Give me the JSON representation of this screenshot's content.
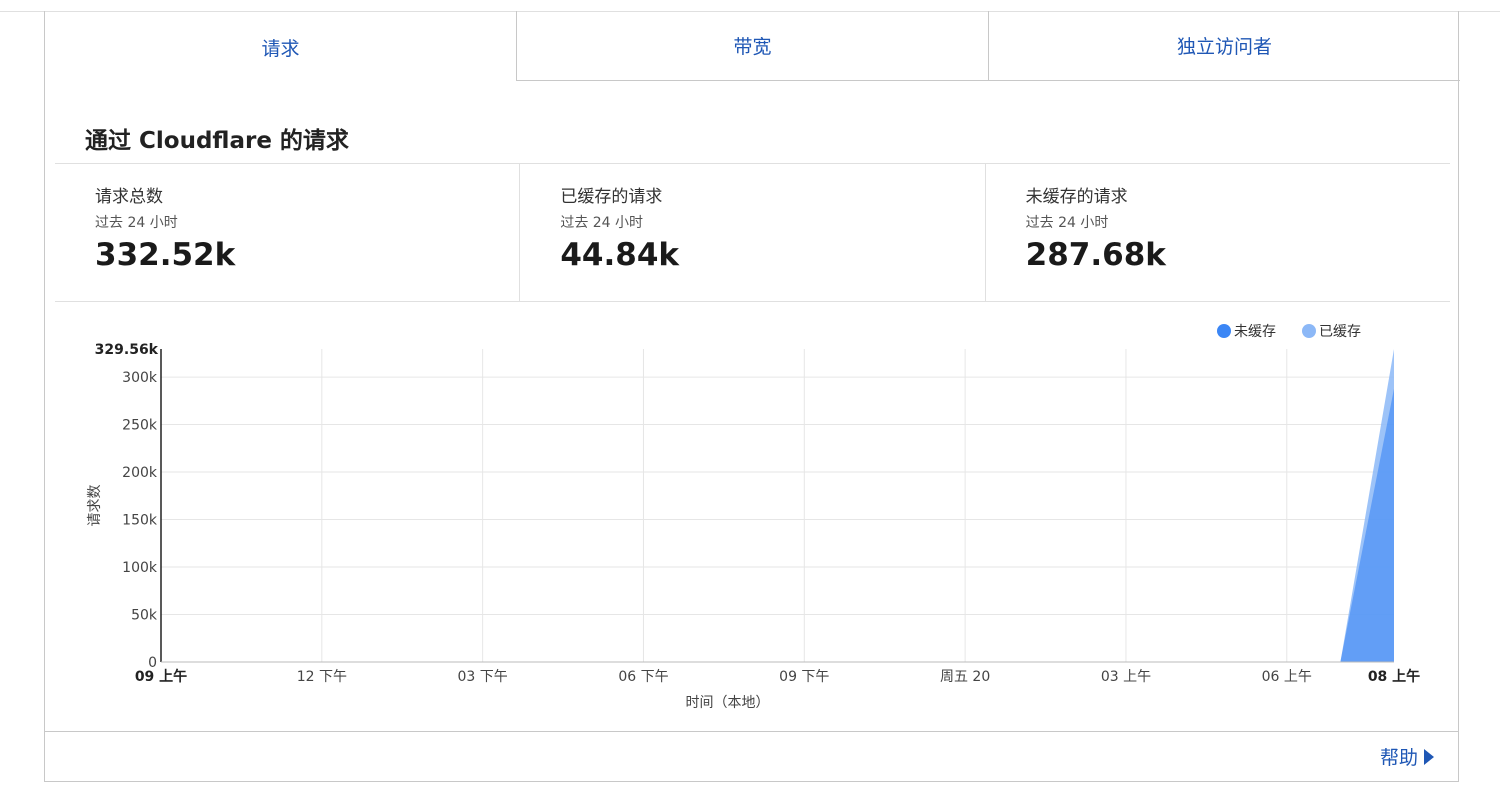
{
  "tabs": [
    {
      "label": "请求",
      "active": true
    },
    {
      "label": "带宽",
      "active": false
    },
    {
      "label": "独立访问者",
      "active": false
    }
  ],
  "section_title": "通过 Cloudflare 的请求",
  "stats": [
    {
      "label": "请求总数",
      "sub": "过去 24 小时",
      "value": "332.52k"
    },
    {
      "label": "已缓存的请求",
      "sub": "过去 24 小时",
      "value": "44.84k"
    },
    {
      "label": "未缓存的请求",
      "sub": "过去 24 小时",
      "value": "287.68k"
    }
  ],
  "help": {
    "label": "帮助"
  },
  "colors": {
    "accent": "#1f57b5",
    "uncached": "#3b86f5",
    "cached": "#8cb8f7"
  },
  "chart_data": {
    "type": "area",
    "xlabel": "时间（本地）",
    "ylabel": "请求数",
    "y_max_label": "329.56k",
    "ylim": [
      0,
      329560
    ],
    "yticks": [
      {
        "value": 0,
        "label": "0"
      },
      {
        "value": 50000,
        "label": "50k"
      },
      {
        "value": 100000,
        "label": "100k"
      },
      {
        "value": 150000,
        "label": "150k"
      },
      {
        "value": 200000,
        "label": "200k"
      },
      {
        "value": 250000,
        "label": "250k"
      },
      {
        "value": 300000,
        "label": "300k"
      }
    ],
    "xticks": [
      {
        "h": 0,
        "label": "09 上午",
        "bold": true
      },
      {
        "h": 3,
        "label": "12 下午",
        "bold": false
      },
      {
        "h": 6,
        "label": "03 下午",
        "bold": false
      },
      {
        "h": 9,
        "label": "06 下午",
        "bold": false
      },
      {
        "h": 12,
        "label": "09 下午",
        "bold": false
      },
      {
        "h": 15,
        "label": "周五 20",
        "bold": false
      },
      {
        "h": 18,
        "label": "03 上午",
        "bold": false
      },
      {
        "h": 21,
        "label": "06 上午",
        "bold": false
      },
      {
        "h": 23,
        "label": "08 上午",
        "bold": true
      }
    ],
    "x_range": [
      0,
      23
    ],
    "legend": [
      "未缓存",
      "已缓存"
    ],
    "legend_position": "top-right",
    "series": [
      {
        "name": "已缓存",
        "x": [
          0,
          10,
          12,
          14,
          16,
          18,
          22,
          23
        ],
        "values": [
          0,
          0,
          500,
          0,
          500,
          0,
          0,
          329560
        ]
      },
      {
        "name": "未缓存",
        "x": [
          0,
          22,
          23
        ],
        "values": [
          0,
          0,
          287680
        ]
      }
    ]
  }
}
